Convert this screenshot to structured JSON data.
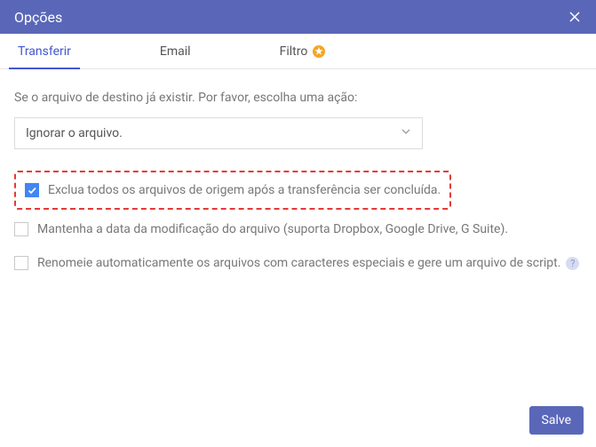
{
  "header": {
    "title": "Opções"
  },
  "tabs": [
    {
      "label": "Transferir",
      "active": true
    },
    {
      "label": "Email"
    },
    {
      "label": "Filtro",
      "badge": true
    }
  ],
  "select_label": "Se o arquivo de destino já existir. Por favor, escolha uma ação:",
  "select_value": "Ignorar o arquivo.",
  "options": [
    {
      "label": "Exclua todos os arquivos de origem após a transferência ser concluída.",
      "checked": true,
      "highlight": true
    },
    {
      "label": "Mantenha a data da modificação do arquivo (suporta Dropbox, Google Drive, G Suite).",
      "checked": false
    },
    {
      "label": "Renomeie automaticamente os arquivos com caracteres especiais e gere um arquivo de script.",
      "checked": false,
      "help": true
    }
  ],
  "save_label": "Salve"
}
